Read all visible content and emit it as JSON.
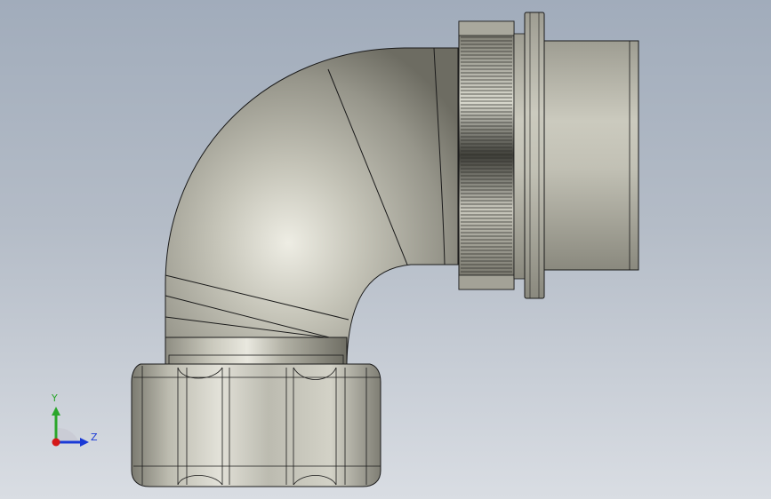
{
  "viewport": {
    "background_top": "#a1acbb",
    "background_bottom": "#d9dde3"
  },
  "model": {
    "description_icon": "elbow-connector-model",
    "body_color": "#b5b4a8",
    "edge_color": "#1a1a1a"
  },
  "triad": {
    "y_label": "Y",
    "z_label": "Z",
    "y_color": "#2aa62a",
    "z_color": "#1a3ad6",
    "x_color": "#d41818"
  }
}
